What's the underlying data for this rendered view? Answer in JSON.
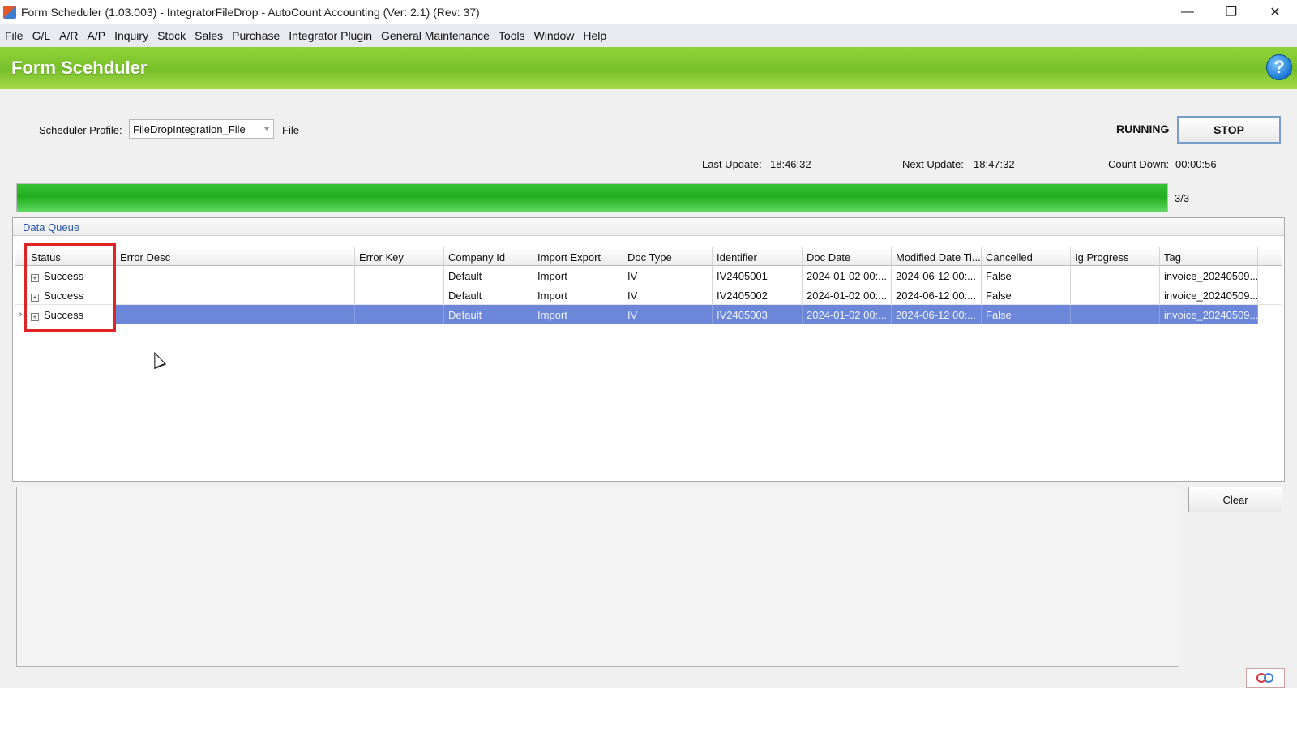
{
  "window": {
    "title": "Form Scheduler (1.03.003) - IntegratorFileDrop - AutoCount Accounting (Ver: 2.1) (Rev: 37)",
    "controls": {
      "minimize": "—",
      "restore": "❐",
      "close": "✕"
    }
  },
  "menu": [
    "File",
    "G/L",
    "A/R",
    "A/P",
    "Inquiry",
    "Stock",
    "Sales",
    "Purchase",
    "Integrator Plugin",
    "General Maintenance",
    "Tools",
    "Window",
    "Help"
  ],
  "header": {
    "title": "Form Scehduler",
    "help_icon": "?"
  },
  "profile": {
    "label": "Scheduler Profile:",
    "value": "FileDropIntegration_File",
    "type_text": "File"
  },
  "status": {
    "state": "RUNNING",
    "stop_label": "STOP",
    "last_update_label": "Last Update:",
    "last_update": "18:46:32",
    "next_update_label": "Next Update:",
    "next_update": "18:47:32",
    "countdown_label": "Count Down:",
    "countdown": "00:00:56"
  },
  "progress": {
    "text": "3/3",
    "fraction": 1.0
  },
  "queue": {
    "title": "Data Queue",
    "columns": [
      "Status",
      "Error Desc",
      "Error Key",
      "Company Id",
      "Import Export",
      "Doc Type",
      "Identifier",
      "Doc Date",
      "Modified Date Ti...",
      "Cancelled",
      "Ig Progress",
      "Tag"
    ],
    "rows": [
      {
        "indicator": "",
        "cells": [
          "Success",
          "",
          "",
          "Default",
          "Import",
          "IV",
          "IV2405001",
          "2024-01-02 00:...",
          "2024-06-12 00:...",
          "False",
          "",
          "invoice_20240509..."
        ]
      },
      {
        "indicator": "",
        "cells": [
          "Success",
          "",
          "",
          "Default",
          "Import",
          "IV",
          "IV2405002",
          "2024-01-02 00:...",
          "2024-06-12 00:...",
          "False",
          "",
          "invoice_20240509..."
        ]
      },
      {
        "indicator": "›",
        "cells": [
          "Success",
          "",
          "",
          "Default",
          "Import",
          "IV",
          "IV2405003",
          "2024-01-02 00:...",
          "2024-06-12 00:...",
          "False",
          "",
          "invoice_20240509..."
        ]
      }
    ],
    "expand_icon": "+"
  },
  "log": {
    "clear_label": "Clear"
  },
  "brand": {
    "logo_icon": "autocount-logo-icon"
  },
  "colors": {
    "header_green": "#78c02a",
    "selection_blue": "#6c87d9",
    "highlight_red": "#e02424",
    "progress_green": "#1fae1f"
  }
}
